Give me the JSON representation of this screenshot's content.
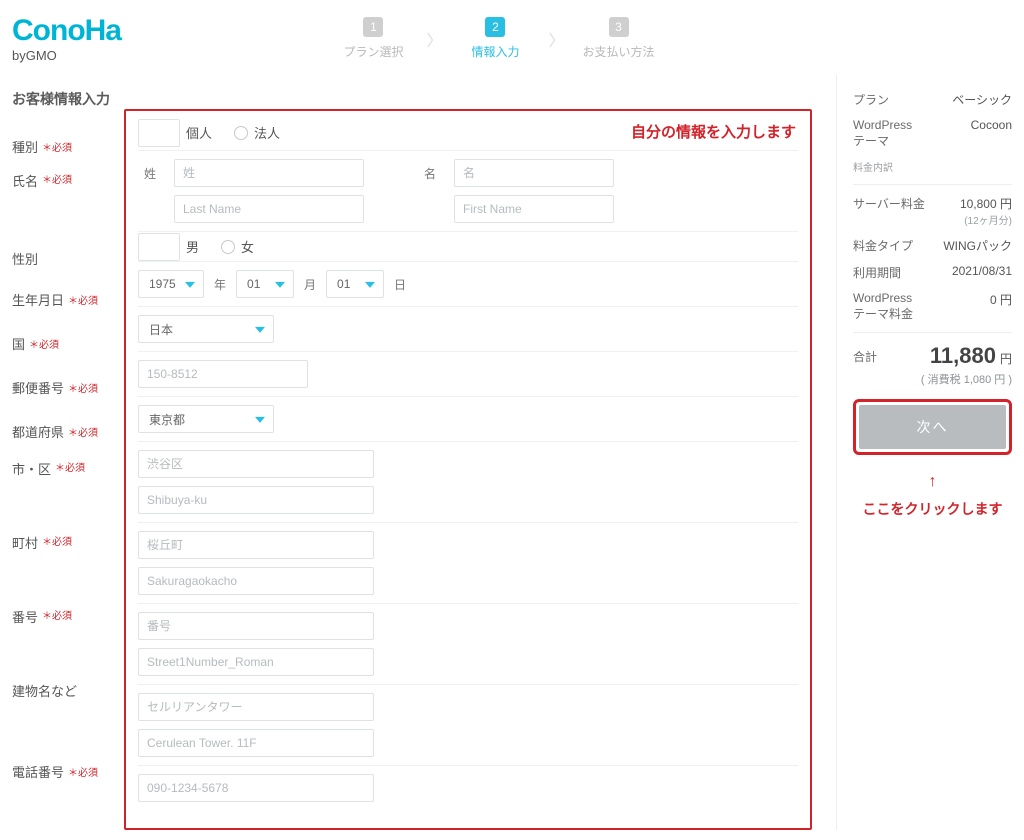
{
  "logo": {
    "text": "ConoHa",
    "sub": "byGMO"
  },
  "steps": [
    {
      "num": "1",
      "label": "プラン選択",
      "active": false
    },
    {
      "num": "2",
      "label": "情報入力",
      "active": true
    },
    {
      "num": "3",
      "label": "お支払い方法",
      "active": false
    }
  ],
  "section_title": "お客様情報入力",
  "notes": {
    "redbox": "自分の情報を入力します",
    "arrow": "↑",
    "click_here": "ここをクリックします"
  },
  "labels": {
    "required": "＊必須",
    "type": "種別",
    "type_individual": "個人",
    "type_corporate": "法人",
    "name": "氏名",
    "name_sei": "姓",
    "name_mei": "名",
    "ph_sei": "姓",
    "ph_mei": "名",
    "ph_last": "Last Name",
    "ph_first": "First Name",
    "gender": "性別",
    "gender_m": "男",
    "gender_f": "女",
    "dob": "生年月日",
    "dob_year": "1975",
    "dob_month": "01",
    "dob_day": "01",
    "unit_year": "年",
    "unit_month": "月",
    "unit_day": "日",
    "country": "国",
    "country_val": "日本",
    "postal": "郵便番号",
    "postal_ph": "150-8512",
    "pref": "都道府県",
    "pref_val": "東京都",
    "city": "市・区",
    "city_ph1": "渋谷区",
    "city_ph2": "Shibuya-ku",
    "town": "町村",
    "town_ph1": "桜丘町",
    "town_ph2": "Sakuragaokacho",
    "street": "番号",
    "street_ph1": "番号",
    "street_ph2": "Street1Number_Roman",
    "bldg": "建物名など",
    "bldg_ph1": "セルリアンタワー",
    "bldg_ph2": "Cerulean Tower. 11F",
    "tel": "電話番号",
    "tel_ph": "090-1234-5678"
  },
  "summary": {
    "plan_k": "プラン",
    "plan_v": "ベーシック",
    "theme_k": "WordPress\nテーマ",
    "theme_v": "Cocoon",
    "breakdown": "料金内訳",
    "server_k": "サーバー料金",
    "server_v": "10,800 円",
    "server_sub": "(12ヶ月分)",
    "type_k": "料金タイプ",
    "type_v": "WINGパック",
    "period_k": "利用期間",
    "period_v": "2021/08/31",
    "wptheme_k": "WordPress\nテーマ料金",
    "wptheme_v": "0 円",
    "total_k": "合計",
    "total_v": "11,880",
    "total_yen": "円",
    "tax": "( 消費税 1,080 円 )",
    "next": "次へ"
  }
}
